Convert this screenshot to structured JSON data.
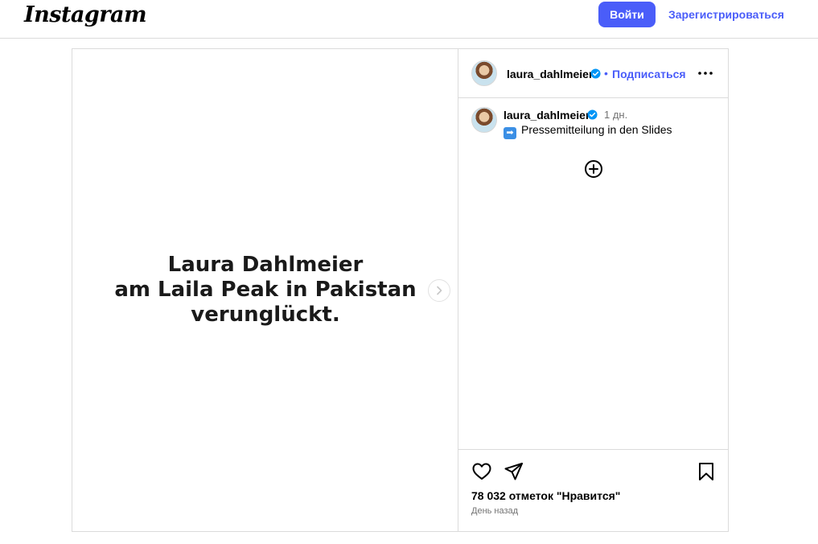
{
  "nav": {
    "logo": "Instagram",
    "login_label": "Войти",
    "signup_label": "Зарегистрироваться"
  },
  "media": {
    "line1": "Laura Dahlmeier",
    "line2": "am Laila Peak in Pakistan",
    "line3": "verunglückt.",
    "next_icon": "chevron-right-icon"
  },
  "header": {
    "username": "laura_dahlmeier",
    "dot": "•",
    "follow_label": "Подписаться",
    "more_icon": "more-horizontal-icon"
  },
  "caption": {
    "username": "laura_dahlmeier",
    "time": "1 дн.",
    "emoji": "➡",
    "text": "Pressemitteilung in den Slides",
    "load_more_icon": "plus-circle-icon"
  },
  "actions": {
    "likes_text": "78 032 отметок \"Нравится\"",
    "date": "День назад",
    "icons": [
      "heart-icon",
      "share-icon",
      "bookmark-icon"
    ]
  },
  "colors": {
    "accent": "#4a5df9",
    "verified": "#0095f6",
    "border": "#dbdbdb",
    "muted": "#737373"
  }
}
